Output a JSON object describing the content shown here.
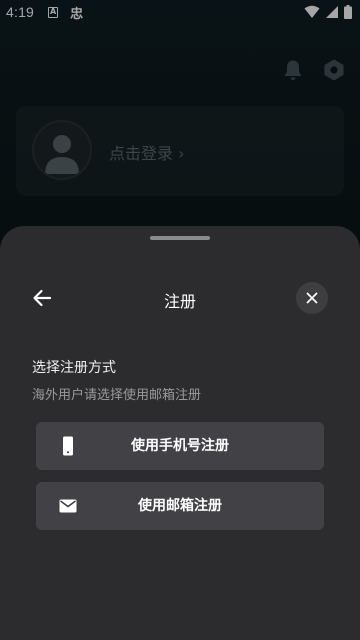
{
  "status_bar": {
    "time": "4:19",
    "icons": [
      "a-icon",
      "bug-icon",
      "wifi-icon",
      "signal-icon",
      "battery-icon"
    ]
  },
  "background": {
    "login_prompt": "点击登录 ›",
    "icons": [
      "bell-icon",
      "settings-hex-icon",
      "avatar-icon"
    ]
  },
  "sheet": {
    "title": "注册",
    "section_title": "选择注册方式",
    "section_subtitle": "海外用户请选择使用邮箱注册",
    "options": [
      {
        "label": "使用手机号注册",
        "icon": "phone-icon"
      },
      {
        "label": "使用邮箱注册",
        "icon": "mail-icon"
      }
    ]
  },
  "colors": {
    "sheet_bg": "#2c2c2e",
    "button_bg": "#424246",
    "close_bg": "#3e3e41",
    "muted_text": "#9a9a9d"
  }
}
